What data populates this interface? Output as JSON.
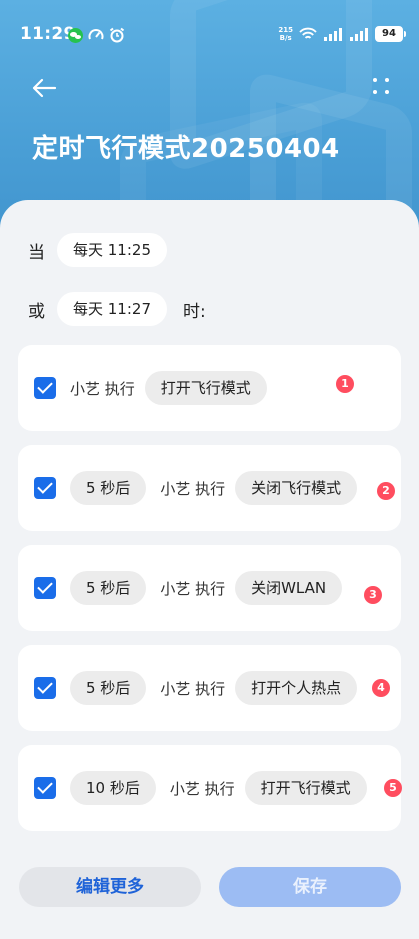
{
  "status_bar": {
    "time": "11:29",
    "net_speed_value": "215",
    "net_speed_unit": "B/s",
    "battery": "94"
  },
  "header": {
    "title": "定时飞行模式20250404"
  },
  "trigger": {
    "when_label": "当",
    "when_value": "每天 11:25",
    "or_label": "或",
    "or_value": "每天 11:27",
    "suffix": "时:"
  },
  "actions": [
    {
      "delay": "",
      "agent": "小艺 执行",
      "action": "打开飞行模式",
      "badge": "1",
      "checked": true
    },
    {
      "delay": "5 秒后",
      "agent": "小艺 执行",
      "action": "关闭飞行模式",
      "badge": "2",
      "checked": true
    },
    {
      "delay": "5 秒后",
      "agent": "小艺 执行",
      "action": "关闭WLAN",
      "badge": "3",
      "checked": true
    },
    {
      "delay": "5 秒后",
      "agent": "小艺 执行",
      "action": "打开个人热点",
      "badge": "4",
      "checked": true
    },
    {
      "delay": "10 秒后",
      "agent": "小艺 执行",
      "action": "打开飞行模式",
      "badge": "5",
      "checked": true
    }
  ],
  "footer": {
    "edit_more_label": "编辑更多",
    "save_label": "保存"
  },
  "colors": {
    "header_blue": "#4a9fd6",
    "checkbox_blue": "#1a6de9",
    "badge_red": "#ff4d5f",
    "save_disabled": "#9cbcf3",
    "edit_text": "#1f63d8"
  },
  "icons": {
    "back": "arrow-left-icon",
    "more": "more-vertical-icon",
    "wechat": "wechat-icon",
    "speed": "speedometer-icon",
    "alarm": "alarm-icon",
    "wifi": "wifi-icon",
    "signal": "signal-icon",
    "battery": "battery-icon"
  }
}
